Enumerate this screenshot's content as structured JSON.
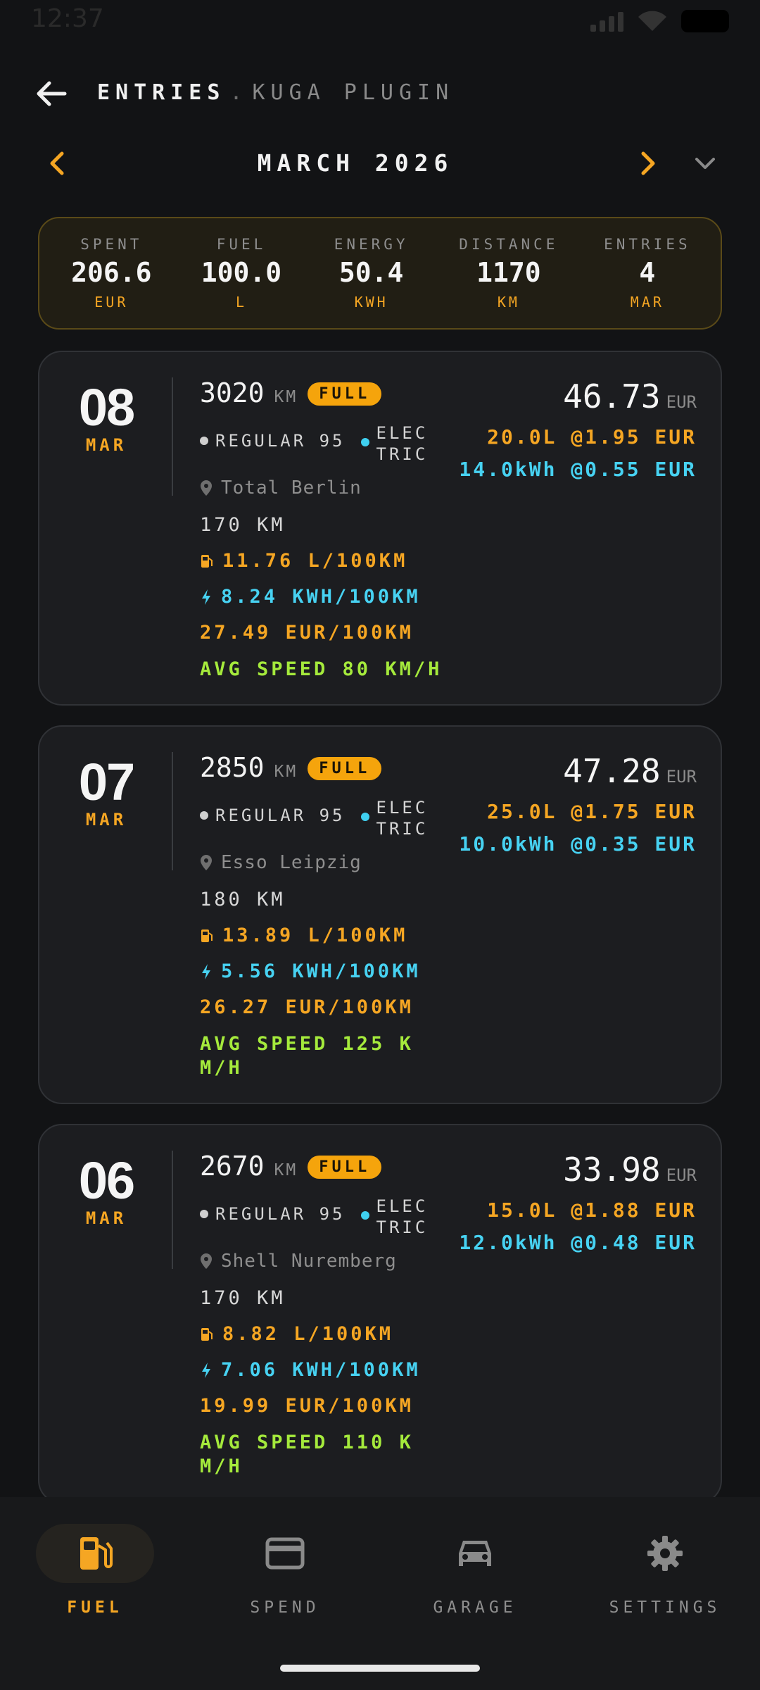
{
  "status": {
    "time": "12:37"
  },
  "header": {
    "title": "ENTRIES",
    "separator": ".",
    "subtitle": "KUGA PLUGIN"
  },
  "month": {
    "label": "MARCH 2026"
  },
  "summary": [
    {
      "label": "SPENT",
      "value": "206.6",
      "unit": "EUR"
    },
    {
      "label": "FUEL",
      "value": "100.0",
      "unit": "L"
    },
    {
      "label": "ENERGY",
      "value": "50.4",
      "unit": "KWH"
    },
    {
      "label": "DISTANCE",
      "value": "1170",
      "unit": "KM"
    },
    {
      "label": "ENTRIES",
      "value": "4",
      "unit": "MAR"
    }
  ],
  "entries": [
    {
      "day": "08",
      "month": "MAR",
      "odometer": "3020",
      "odo_unit": "KM",
      "badge": "FULL",
      "fuel_a": "REGULAR 95",
      "fuel_b": "ELECTRIC",
      "location": "Total Berlin",
      "distance": "170 KM",
      "consumption_fuel": "11.76 L/100KM",
      "consumption_elec": "8.24 KWH/100KM",
      "cost_per_100": "27.49 EUR/100KM",
      "avg_speed": "AVG SPEED 80 KM/H",
      "total": "46.73",
      "total_unit": "EUR",
      "fuel_price": "20.0L @1.95 EUR",
      "elec_price": "14.0kWh @0.55 EUR"
    },
    {
      "day": "07",
      "month": "MAR",
      "odometer": "2850",
      "odo_unit": "KM",
      "badge": "FULL",
      "fuel_a": "REGULAR 95",
      "fuel_b": "ELECTRIC",
      "location": "Esso Leipzig",
      "distance": "180 KM",
      "consumption_fuel": "13.89 L/100KM",
      "consumption_elec": "5.56 KWH/100KM",
      "cost_per_100": "26.27 EUR/100KM",
      "avg_speed": "AVG SPEED 125 KM/H",
      "total": "47.28",
      "total_unit": "EUR",
      "fuel_price": "25.0L @1.75 EUR",
      "elec_price": "10.0kWh @0.35 EUR"
    },
    {
      "day": "06",
      "month": "MAR",
      "odometer": "2670",
      "odo_unit": "KM",
      "badge": "FULL",
      "fuel_a": "REGULAR 95",
      "fuel_b": "ELECTRIC",
      "location": "Shell Nuremberg",
      "distance": "170 KM",
      "consumption_fuel": "8.82 L/100KM",
      "consumption_elec": "7.06 KWH/100KM",
      "cost_per_100": "19.99 EUR/100KM",
      "avg_speed": "AVG SPEED 110 KM/H",
      "total": "33.98",
      "total_unit": "EUR",
      "fuel_price": "15.0L @1.88 EUR",
      "elec_price": "12.0kWh @0.48 EUR"
    }
  ],
  "nav": [
    {
      "label": "FUEL",
      "icon": "fuel-pump-icon",
      "active": true
    },
    {
      "label": "SPEND",
      "icon": "credit-card-icon",
      "active": false
    },
    {
      "label": "GARAGE",
      "icon": "car-icon",
      "active": false
    },
    {
      "label": "SETTINGS",
      "icon": "gear-icon",
      "active": false
    }
  ],
  "colors": {
    "accent": "#f5a623",
    "electric": "#47d2f2",
    "speed": "#a5ea3c",
    "background": "#121315",
    "card": "#1c1d20"
  }
}
